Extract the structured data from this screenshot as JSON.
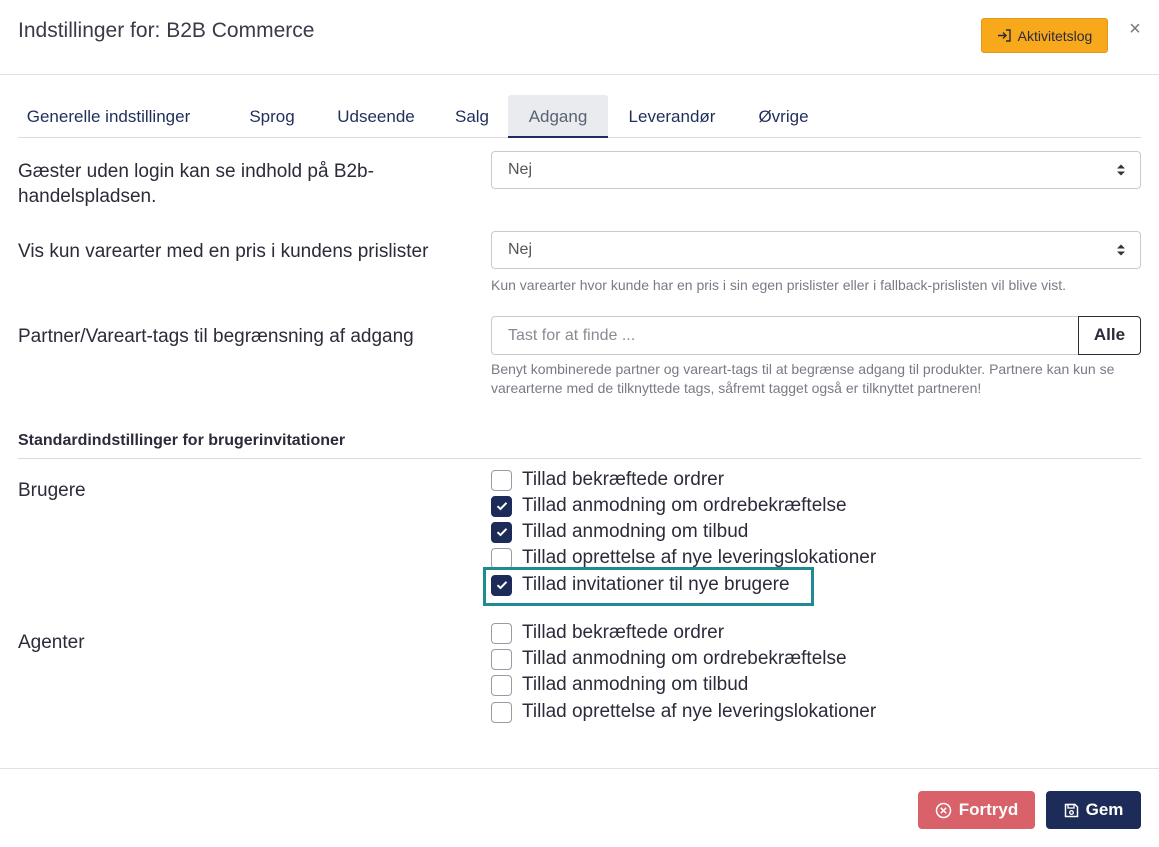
{
  "header": {
    "title": "Indstillinger for: B2B Commerce",
    "activity_log_label": "Aktivitetslog",
    "close_label": "×"
  },
  "tabs": [
    {
      "label": "Generelle indstillinger",
      "active": false
    },
    {
      "label": "Sprog",
      "active": false
    },
    {
      "label": "Udseende",
      "active": false
    },
    {
      "label": "Salg",
      "active": false
    },
    {
      "label": "Adgang",
      "active": true
    },
    {
      "label": "Leverandør",
      "active": false
    },
    {
      "label": "Øvrige",
      "active": false
    }
  ],
  "settings": {
    "guests": {
      "label": "Gæster uden login kan se indhold på B2b-handelspladsen.",
      "value": "Nej"
    },
    "pricelist": {
      "label": "Vis kun varearter med en pris i kundens prislister",
      "value": "Nej",
      "help": "Kun varearter hvor kunde har en pris i sin egen prislister eller i fallback-prislisten vil blive vist."
    },
    "tags": {
      "label": "Partner/Vareart-tags til begrænsning af adgang",
      "placeholder": "Tast for at finde ...",
      "button_label": "Alle",
      "help": "Benyt kombinerede partner og vareart-tags til at begrænse adgang til produkter. Partnere kan kun se varearterne med de tilknyttede tags, såfremt tagget også er tilknyttet partneren!"
    }
  },
  "invitations": {
    "section_title": "Standardindstillinger for brugerinvitationer",
    "users": {
      "label": "Brugere",
      "options": [
        {
          "label": "Tillad bekræftede ordrer",
          "checked": false
        },
        {
          "label": "Tillad anmodning om ordrebekræftelse",
          "checked": true
        },
        {
          "label": "Tillad anmodning om tilbud",
          "checked": true
        },
        {
          "label": "Tillad oprettelse af nye leveringslokationer",
          "checked": false
        },
        {
          "label": "Tillad invitationer til nye brugere",
          "checked": true
        }
      ]
    },
    "agents": {
      "label": "Agenter",
      "options": [
        {
          "label": "Tillad bekræftede ordrer",
          "checked": false
        },
        {
          "label": "Tillad anmodning om ordrebekræftelse",
          "checked": false
        },
        {
          "label": "Tillad anmodning om tilbud",
          "checked": false
        },
        {
          "label": "Tillad oprettelse af nye leveringslokationer",
          "checked": false
        }
      ]
    }
  },
  "footer": {
    "cancel_label": "Fortryd",
    "save_label": "Gem"
  },
  "colors": {
    "primary": "#1c2b57",
    "warning": "#f7a81b",
    "danger": "#d9616a",
    "highlight": "#1f8a8f"
  }
}
